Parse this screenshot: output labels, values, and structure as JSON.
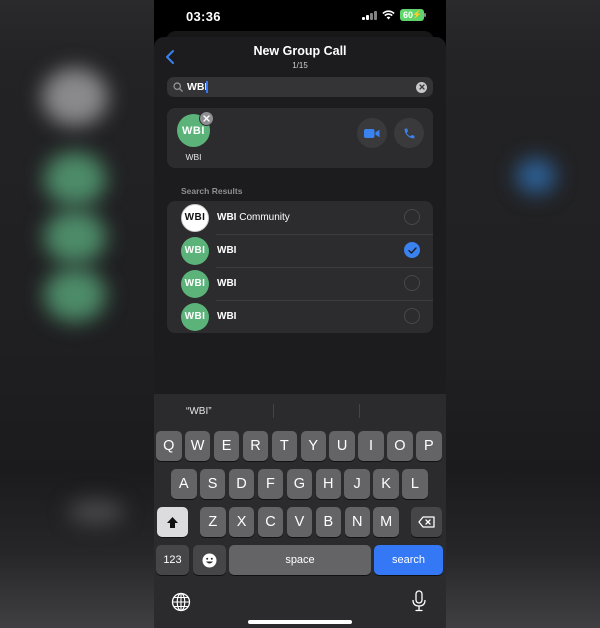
{
  "status_bar": {
    "time": "03:36",
    "battery": "60"
  },
  "nav": {
    "title": "New Group Call",
    "subtitle": "1/15",
    "back_label": "Back"
  },
  "search": {
    "value": "WBI",
    "placeholder": "Search"
  },
  "selected": [
    {
      "name": "WBI",
      "avatar_text": "WBI"
    }
  ],
  "call_actions": {
    "video": "Video call",
    "voice": "Voice call"
  },
  "results_section": {
    "label": "Search Results",
    "items": [
      {
        "name_bold": "WBI",
        "name_rest": " Community",
        "avatar_text": "WBI",
        "avatar_style": "white",
        "checked": false
      },
      {
        "name_bold": "WBI",
        "name_rest": "",
        "avatar_text": "WBI",
        "avatar_style": "green",
        "checked": true
      },
      {
        "name_bold": "WBI",
        "name_rest": "",
        "avatar_text": "WBI",
        "avatar_style": "green",
        "checked": false
      },
      {
        "name_bold": "WBI",
        "name_rest": "",
        "avatar_text": "WBI",
        "avatar_style": "green",
        "checked": false
      }
    ]
  },
  "keyboard": {
    "suggestions": [
      "“WBI”",
      "",
      ""
    ],
    "row1": [
      "Q",
      "W",
      "E",
      "R",
      "T",
      "Y",
      "U",
      "I",
      "O",
      "P"
    ],
    "row2": [
      "A",
      "S",
      "D",
      "F",
      "G",
      "H",
      "J",
      "K",
      "L"
    ],
    "row3": [
      "Z",
      "X",
      "C",
      "V",
      "B",
      "N",
      "M"
    ],
    "numbers_key": "123",
    "space_key": "space",
    "action_key": "search"
  },
  "colors": {
    "accent": "#3478f6",
    "avatar_green": "#5bb37a",
    "battery_green": "#5dd56a"
  }
}
